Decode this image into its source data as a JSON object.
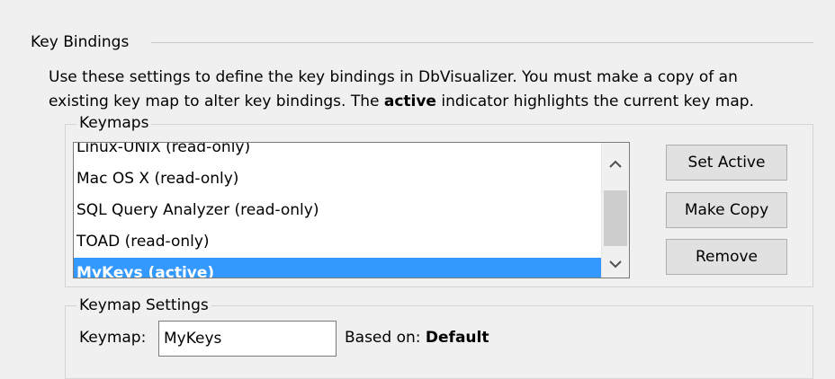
{
  "key_bindings": {
    "title": "Key Bindings",
    "description_line1": "Use these settings to define the key bindings in DbVisualizer. You must make a copy of an",
    "description_line2_prefix": "existing key map to alter key bindings. The ",
    "description_line2_bold": "active",
    "description_line2_suffix": " indicator highlights the current key map."
  },
  "keymaps": {
    "title": "Keymaps",
    "items": [
      "Linux-UNIX  (read-only)",
      "Mac OS X  (read-only)",
      "SQL Query Analyzer  (read-only)",
      "TOAD  (read-only)",
      "MyKeys  (active)"
    ],
    "selected_item": "MyKeys  (active)",
    "buttons": {
      "set_active": "Set Active",
      "make_copy": "Make Copy",
      "remove": "Remove"
    },
    "scrollbar": {
      "up_icon": "chevron-up-icon",
      "down_icon": "chevron-down-icon"
    }
  },
  "keymap_settings": {
    "title": "Keymap Settings",
    "keymap_label": "Keymap:",
    "keymap_value": "MyKeys",
    "based_on_label": "Based on:",
    "based_on_value": "Default"
  },
  "colors": {
    "selection": "#3399ff",
    "window_bg": "#f0f0f0",
    "button_bg": "#e1e1e1"
  }
}
